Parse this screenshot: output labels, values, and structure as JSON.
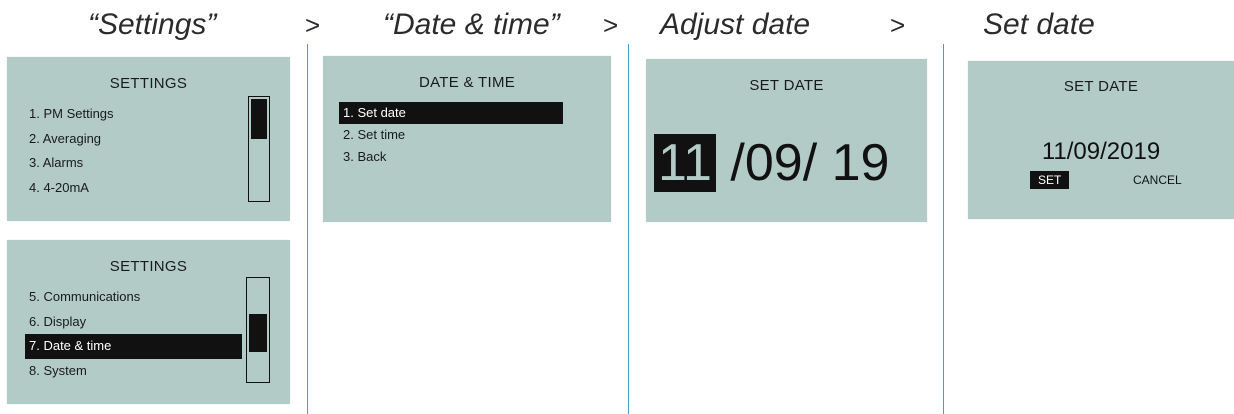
{
  "steps": {
    "settings": "“Settings”",
    "date_time": "“Date & time”",
    "adjust_date": "Adjust date",
    "set_date": "Set date",
    "separator": ">"
  },
  "screen_settings_1": {
    "title": "SETTINGS",
    "items": [
      "1. PM Settings",
      "2. Averaging",
      "3. Alarms",
      "4. 4-20mA"
    ],
    "scroll_position": 0.0
  },
  "screen_settings_2": {
    "title": "SETTINGS",
    "items": [
      "5. Communications",
      "6. Display",
      "7. Date & time",
      "8. System"
    ],
    "selected_index": 2,
    "scroll_position": 0.5
  },
  "screen_date_time": {
    "title": "DATE & TIME",
    "items": [
      "1.  Set date",
      "2. Set time",
      "3. Back"
    ],
    "selected_index": 0
  },
  "screen_adjust_date": {
    "title": "SET DATE",
    "day": "11",
    "rest": " /09/ 19"
  },
  "screen_set_date": {
    "title": "SET DATE",
    "date": "11/09/2019",
    "set_label": "SET",
    "cancel_label": "CANCEL"
  },
  "colors": {
    "lcd_background": "#b2cbc6",
    "divider": "#3aa4d8",
    "ink": "#111111"
  }
}
